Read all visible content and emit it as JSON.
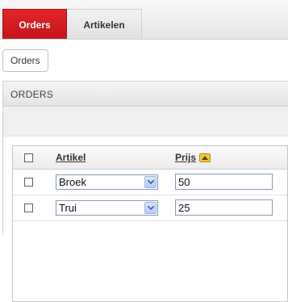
{
  "tabs": [
    {
      "label": "Orders",
      "active": true
    },
    {
      "label": "Artikelen",
      "active": false
    }
  ],
  "breadcrumb": {
    "label": "Orders"
  },
  "panel": {
    "title": "ORDERS"
  },
  "grid": {
    "columns": [
      "Artikel",
      "Prijs"
    ],
    "sort": {
      "column": "Prijs",
      "direction": "ascending",
      "icon": "sort-ascending-icon"
    },
    "rows": [
      {
        "artikel": "Broek",
        "prijs": "50",
        "checked": false
      },
      {
        "artikel": "Trui",
        "prijs": "25",
        "checked": false
      }
    ]
  },
  "colors": {
    "accent": "#d71920",
    "sort_icon": "#f3c93a"
  }
}
